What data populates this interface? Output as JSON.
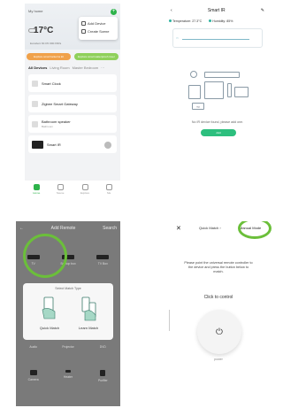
{
  "panel1": {
    "home_label": "My home",
    "temperature": "17°C",
    "weather_line": "Excellent   60.0%    990.9hPa",
    "menu_items": [
      "Add Device",
      "Create Scene"
    ],
    "banner_left": "Explore smart lanterns kit",
    "banner_right": "Explore smart waterproof cover",
    "tabs": [
      "All Devices",
      "Living Room",
      "Master Bedroom",
      "···"
    ],
    "devices": [
      {
        "name": "Smart Clock",
        "sub": ""
      },
      {
        "name": "Zigbee Smart Gateway",
        "sub": ""
      },
      {
        "name": "Bathroom speaker",
        "sub": "Bathroom"
      },
      {
        "name": "Smart IR",
        "sub": ""
      }
    ],
    "nav": [
      "Home",
      "Scene",
      "Explore",
      "Me"
    ]
  },
  "panel2": {
    "back": "‹",
    "title": "Smart IR",
    "edit": "✎",
    "temperature_label": "Temperature:",
    "temperature_value": "27.3°C",
    "humidity_label": "Humidity:",
    "humidity_value": "85%",
    "message": "No IR device found,  please add one.",
    "add_button": "Add",
    "tv_label": "TV"
  },
  "panel3": {
    "back": "←",
    "title": "Add Remote",
    "search": "Search",
    "row1": [
      "TV",
      "Set-top box",
      "TV Box"
    ],
    "row3": [
      "Audio",
      "Projector",
      "DVD"
    ],
    "row4": [
      "Camera",
      "Heater",
      "Purifier"
    ],
    "dialog_title": "Select Match Type",
    "quick_match": "Quick Match",
    "learn_match": "Learn Match"
  },
  "panel4": {
    "close": "✕",
    "quick_match": "Quick Match ›",
    "manual_mode": "Manual Mode",
    "instructions": "Please point the universal remote controller to the device and press the button below to match.",
    "click_to_control": "Click to control",
    "power_label": "power"
  },
  "colors": {
    "accent_green": "#2db34a",
    "highlight_ring": "#6bbf3a",
    "add_button": "#2dbf7e"
  }
}
